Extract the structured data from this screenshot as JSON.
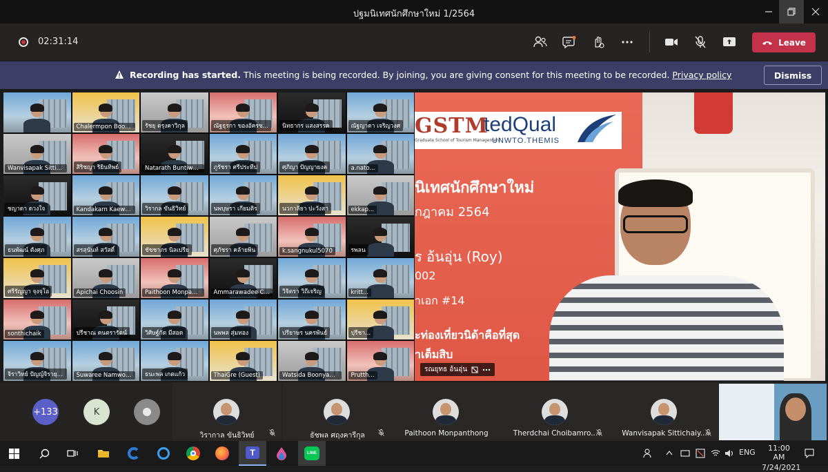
{
  "window": {
    "title": "ปฐมนิเทศนักศึกษาใหม่ 1/2564"
  },
  "toolbar": {
    "timer": "02:31:14",
    "leave_label": "Leave"
  },
  "banner": {
    "bold": "Recording has started.",
    "message": "This meeting is being recorded. By joining, you are giving consent for this meeting to be recorded.",
    "privacy_label": "Privacy policy",
    "dismiss_label": "Dismiss"
  },
  "grid": {
    "tiles": [
      "",
      "Chalermpon Boon...",
      "รัชยุ ตรุงคาวิกุล",
      "ณัฐธุรกา ของอัครช...",
      "นิทธากร แสงสรรค",
      "ณัฐญาดา เจริญวงศ",
      "Wanvisapak Sittic...",
      "สิริชญา ริยินทิพย์",
      "Natarath Buntiwa...",
      "ภูรัชรา ศรีประทีป",
      "ศุภิญา ปัญญายงค",
      "a.nato...",
      "ชญาดา ดวงใจ",
      "Kandakarn Kaewm...",
      "วิรากล ขันธิวิทย์",
      "นพบุษรา เกียมติร",
      "นวกาลียา ปะวังสา",
      "ekkap...",
      "ธนพัฒน์ ตังศุภ",
      "สรสุนันท์ สวัสดิ์",
      "ชัชชาภร นิลเปรีย",
      "ศุภัชรา คล้ายพิน",
      "k.sangnukul5070",
      "รพลน",
      "ศรีรัญญา จุงจุโอ",
      "Apichai Choosin",
      "Paithoon Monpanth...",
      "Ammarawadee Ch...",
      "วิจิตรา วิถีเจริญ",
      "kritt...",
      "sonthichaik",
      "ปรีชาณ คนตรารัตน์",
      "วิศิษฐ์กัต มีสอด",
      "นพพล สุ่มทอง",
      "ปรียาษร นครพันธ์",
      "ปุรีชา...",
      "จิราวิทย์ ปัญญ์จิรายุวาน",
      "Suwaree Namwong",
      "ธนะพล เกตแก้ว",
      "ThaiGre (Guest)",
      "Watsida Boonyan...",
      "Prutth..."
    ]
  },
  "presenter": {
    "logo_left": "GSTM",
    "logo_right": "tedQual",
    "logo_sub": "UNWTO.THEMIS",
    "school_sub": "Graduate School of Tourism Management",
    "line1": "นิเทศนักศึกษาใหม่",
    "line2": "กฎาคม 2564",
    "line3": "ร อ้นอุ่น (Roy)",
    "line4": "002",
    "line5": "าเอก #14",
    "line6": "ะท่องเที่ยวนิด้าคือที่สุด",
    "line7": "าเต็มสิบ",
    "name": "รณยุทธ อ้นอุ่น"
  },
  "strip": {
    "overflow_count": "+133",
    "initial": "K",
    "participants": [
      {
        "name": "วิรากาล ขันธิวิทย์"
      },
      {
        "name": "ธัชพล ศฤงคารีกุล"
      },
      {
        "name": "Paithoon Monpanthong"
      },
      {
        "name": "Therdchai Choibamro..."
      },
      {
        "name": "Wanvisapak Sittichaiy..."
      }
    ]
  },
  "taskbar": {
    "lang": "ENG",
    "time": "11:00 AM",
    "date": "7/24/2021"
  },
  "colors": {
    "leave": "#c4314b",
    "banner": "#3d3e66",
    "toolbar": "#252423"
  }
}
